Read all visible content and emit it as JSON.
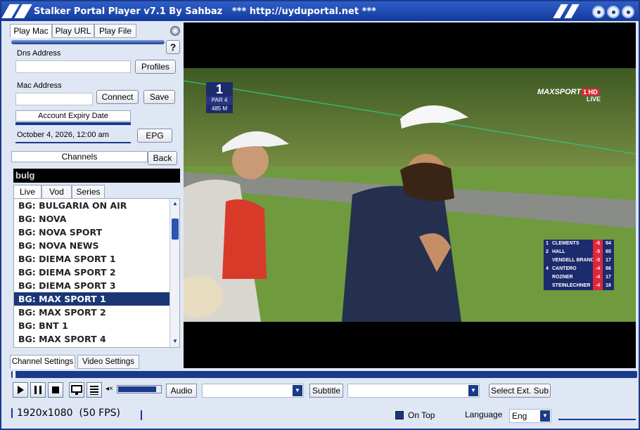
{
  "window": {
    "title": "Stalker Portal Player v7.1 By Sahbaz",
    "subtitle": "*** http://uyduportal.net ***"
  },
  "play_tabs": [
    "Play Mac",
    "Play URL",
    "Play File"
  ],
  "help_label": "?",
  "dns": {
    "label": "Dns Address",
    "value": "",
    "profiles_label": "Profiles"
  },
  "mac": {
    "label": "Mac Address",
    "value": "",
    "connect_label": "Connect",
    "save_label": "Save"
  },
  "expiry": {
    "label": "Account Expiry Date",
    "value": "October 4, 2026, 12:00 am",
    "epg_label": "EPG"
  },
  "channels": {
    "header": "Channels",
    "back_label": "Back",
    "search_value": "bulg"
  },
  "content_tabs": [
    "Live",
    "Vod",
    "Series"
  ],
  "channel_list": [
    "BG: BULGARIA ON AIR",
    "BG: NOVA",
    "BG: NOVA SPORT",
    "BG: NOVA NEWS",
    "BG: DIEMA SPORT 1",
    "BG: DIEMA SPORT 2",
    "BG: DIEMA SPORT 3",
    "BG: MAX SPORT 1",
    "BG: MAX SPORT 2",
    "BG: BNT 1",
    "BG: MAX SPORT 4"
  ],
  "selected_channel_index": 7,
  "settings_tabs": [
    "Channel Settings",
    "Video Settings"
  ],
  "overlay": {
    "hole_number": "1",
    "par": "PAR 4",
    "distance": "485 M",
    "broadcaster": "MAXSPORT",
    "broadcaster_sub": "1 HD",
    "live": "LIVE",
    "leaderboard": [
      {
        "pos": "1",
        "name": "CLEMENTS",
        "score": "-6",
        "thru": "64"
      },
      {
        "pos": "2",
        "name": "HALL",
        "score": "-5",
        "thru": "65"
      },
      {
        "pos": "",
        "name": "VENDELL BRANDEN",
        "score": "-5",
        "thru": "17"
      },
      {
        "pos": "4",
        "name": "CANTERO",
        "score": "-4",
        "thru": "66"
      },
      {
        "pos": "",
        "name": "ROZNER",
        "score": "-4",
        "thru": "17"
      },
      {
        "pos": "",
        "name": "STEINLECHNER",
        "score": "-4",
        "thru": "16"
      }
    ]
  },
  "controls": {
    "audio_label": "Audio",
    "subtitle_label": "Subtitle",
    "select_ext_sub_label": "Select Ext. Sub",
    "volume": 0.9
  },
  "status": {
    "resolution": "1920x1080",
    "fps": "(50 FPS)",
    "on_top_label": "On Top",
    "language_label": "Language",
    "language_value": "Eng"
  },
  "colors": {
    "titlebar": "#1a3a8a",
    "selected_row": "#1a3675",
    "accent_red": "#e0263a"
  }
}
